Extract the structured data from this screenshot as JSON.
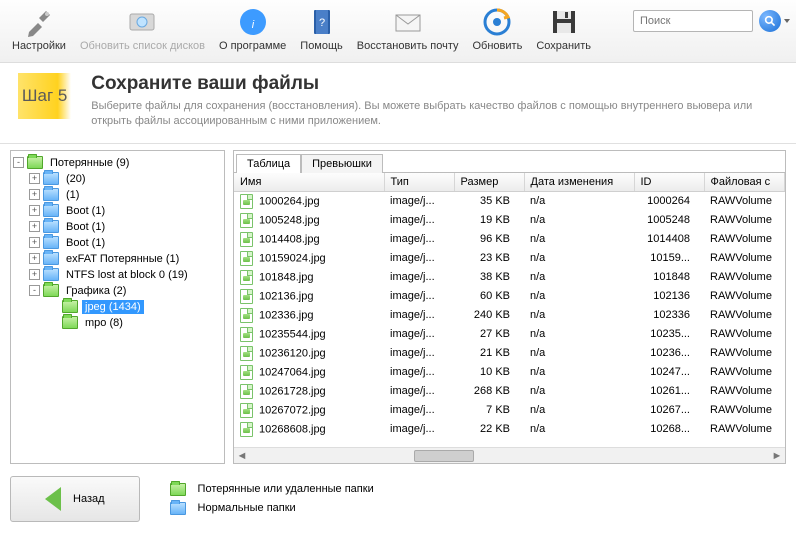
{
  "toolbar": {
    "settings": "Настройки",
    "refresh_disks": "Обновить список дисков",
    "about": "О программе",
    "help": "Помощь",
    "recover_mail": "Восстановить почту",
    "refresh": "Обновить",
    "save": "Сохранить",
    "search_placeholder": "Поиск"
  },
  "step": {
    "badge": "Шаг 5",
    "title": "Сохраните ваши файлы",
    "desc": "Выберите файлы для сохранения (восстановления). Вы можете выбрать качество файлов с помощью внутреннего вьювера или открыть файлы ассоциированным с ними приложением."
  },
  "tree": [
    {
      "label": "Потерянные (9)",
      "type": "green",
      "exp": "-",
      "children": [
        {
          "label": " (20)",
          "type": "blue",
          "exp": "+"
        },
        {
          "label": " (1)",
          "type": "blue",
          "exp": "+"
        },
        {
          "label": "Boot (1)",
          "type": "blue",
          "exp": "+"
        },
        {
          "label": "Boot (1)",
          "type": "blue",
          "exp": "+"
        },
        {
          "label": "Boot (1)",
          "type": "blue",
          "exp": "+"
        },
        {
          "label": "exFAT Потерянные (1)",
          "type": "blue",
          "exp": "+"
        },
        {
          "label": "NTFS lost at block 0 (19)",
          "type": "blue",
          "exp": "+"
        },
        {
          "label": "Графика (2)",
          "type": "green",
          "exp": "-",
          "children": [
            {
              "label": "jpeg (1434)",
              "type": "green",
              "exp": "",
              "selected": true
            },
            {
              "label": "mpo (8)",
              "type": "green",
              "exp": ""
            }
          ]
        }
      ]
    }
  ],
  "tabs": {
    "table": "Таблица",
    "thumbs": "Превьюшки"
  },
  "columns": {
    "name": "Имя",
    "type": "Тип",
    "size": "Размер",
    "date": "Дата изменения",
    "id": "ID",
    "fs": "Файловая с"
  },
  "rows": [
    {
      "name": "1000264.jpg",
      "type": "image/j...",
      "size": "35 KB",
      "date": "n/a",
      "id": "1000264",
      "fs": "RAWVolume"
    },
    {
      "name": "1005248.jpg",
      "type": "image/j...",
      "size": "19 KB",
      "date": "n/a",
      "id": "1005248",
      "fs": "RAWVolume"
    },
    {
      "name": "1014408.jpg",
      "type": "image/j...",
      "size": "96 KB",
      "date": "n/a",
      "id": "1014408",
      "fs": "RAWVolume"
    },
    {
      "name": "10159024.jpg",
      "type": "image/j...",
      "size": "23 KB",
      "date": "n/a",
      "id": "10159...",
      "fs": "RAWVolume"
    },
    {
      "name": "101848.jpg",
      "type": "image/j...",
      "size": "38 KB",
      "date": "n/a",
      "id": "101848",
      "fs": "RAWVolume"
    },
    {
      "name": "102136.jpg",
      "type": "image/j...",
      "size": "60 KB",
      "date": "n/a",
      "id": "102136",
      "fs": "RAWVolume"
    },
    {
      "name": "102336.jpg",
      "type": "image/j...",
      "size": "240 KB",
      "date": "n/a",
      "id": "102336",
      "fs": "RAWVolume"
    },
    {
      "name": "10235544.jpg",
      "type": "image/j...",
      "size": "27 KB",
      "date": "n/a",
      "id": "10235...",
      "fs": "RAWVolume"
    },
    {
      "name": "10236120.jpg",
      "type": "image/j...",
      "size": "21 KB",
      "date": "n/a",
      "id": "10236...",
      "fs": "RAWVolume"
    },
    {
      "name": "10247064.jpg",
      "type": "image/j...",
      "size": "10 KB",
      "date": "n/a",
      "id": "10247...",
      "fs": "RAWVolume"
    },
    {
      "name": "10261728.jpg",
      "type": "image/j...",
      "size": "268 KB",
      "date": "n/a",
      "id": "10261...",
      "fs": "RAWVolume"
    },
    {
      "name": "10267072.jpg",
      "type": "image/j...",
      "size": "7 KB",
      "date": "n/a",
      "id": "10267...",
      "fs": "RAWVolume"
    },
    {
      "name": "10268608.jpg",
      "type": "image/j...",
      "size": "22 KB",
      "date": "n/a",
      "id": "10268...",
      "fs": "RAWVolume"
    }
  ],
  "footer": {
    "back": "Назад",
    "legend_lost": "Потерянные или удаленные папки",
    "legend_normal": "Нормальные папки"
  }
}
